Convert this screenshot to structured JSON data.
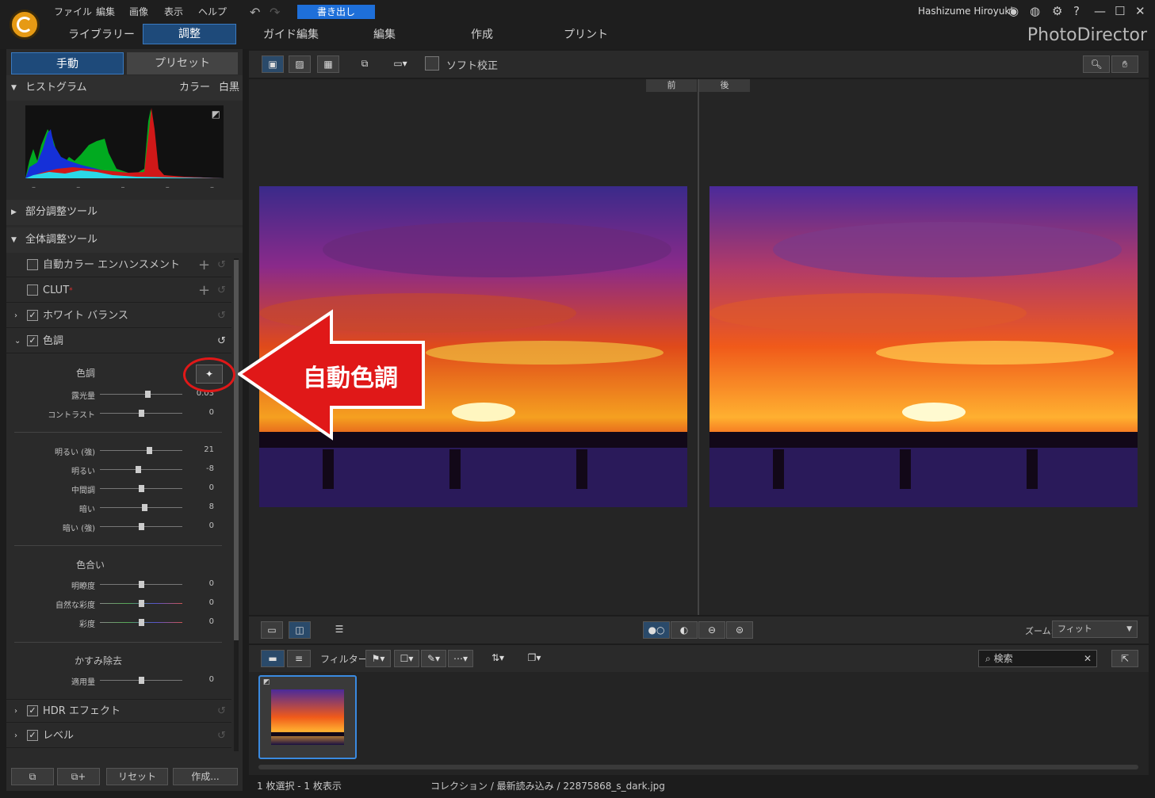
{
  "menu": [
    "ファイル",
    "編集",
    "画像",
    "表示",
    "ヘルプ"
  ],
  "export_label": "書き出し",
  "user_name": "Hashizume Hiroyuki",
  "modes": [
    "ライブラリー",
    "調整",
    "ガイド編集",
    "編集",
    "作成",
    "プリント"
  ],
  "brand": "PhotoDirector",
  "left_tabs": [
    "手動",
    "プリセット"
  ],
  "histogram": {
    "title": "ヒストグラム",
    "color": "カラー",
    "mono": "白黒",
    "ticks": [
      "–",
      "–",
      "–",
      "–",
      "–"
    ]
  },
  "sections": {
    "local": "部分調整ツール",
    "global": "全体調整ツール"
  },
  "tools": {
    "auto_color": "自動カラー エンハンスメント",
    "clut": "CLUT",
    "white_balance": "ホワイト バランス",
    "tone": "色調",
    "hdr": "HDR エフェクト",
    "levels": "レベル"
  },
  "tone_panel": {
    "heading": "色調",
    "sliders1": [
      {
        "label": "露光量",
        "value": "0.03",
        "pos": 0.58
      },
      {
        "label": "コントラスト",
        "value": "0",
        "pos": 0.5
      }
    ],
    "sliders2": [
      {
        "label": "明るい (強)",
        "value": "21",
        "pos": 0.6
      },
      {
        "label": "明るい",
        "value": "-8",
        "pos": 0.46
      },
      {
        "label": "中間調",
        "value": "0",
        "pos": 0.5
      },
      {
        "label": "暗い",
        "value": "8",
        "pos": 0.54
      },
      {
        "label": "暗い (強)",
        "value": "0",
        "pos": 0.5
      }
    ],
    "hue_heading": "色合い",
    "sliders3": [
      {
        "label": "明瞭度",
        "value": "0",
        "pos": 0.5
      },
      {
        "label": "自然な彩度",
        "value": "0",
        "pos": 0.5
      },
      {
        "label": "彩度",
        "value": "0",
        "pos": 0.5
      }
    ],
    "haze_heading": "かすみ除去",
    "sliders4": [
      {
        "label": "適用量",
        "value": "0",
        "pos": 0.5
      }
    ]
  },
  "bottom_buttons": [
    "リセット",
    "作成..."
  ],
  "toolbar": {
    "soft_proof": "ソフト校正"
  },
  "before_after": {
    "before": "前",
    "after": "後"
  },
  "filter_label": "フィルター:",
  "zoom": {
    "label": "ズーム:",
    "value": "フィット"
  },
  "search_placeholder": "検索",
  "status": {
    "selection": "1 枚選択 - 1 枚表示",
    "path": "コレクション / 最新読み込み / 22875868_s_dark.jpg"
  },
  "annotation": "自動色調"
}
